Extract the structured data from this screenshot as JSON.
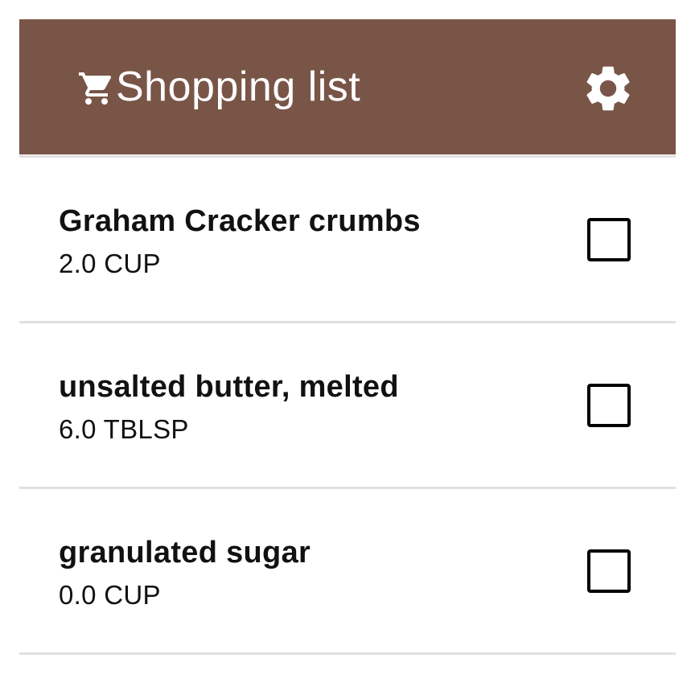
{
  "app_bar": {
    "title": "Shopping list",
    "cart_icon": "shopping-cart-icon",
    "settings_icon": "gear-icon",
    "background_color": "#795548",
    "text_color": "#ffffff"
  },
  "items": [
    {
      "name": "Graham Cracker crumbs",
      "quantity": "2.0 CUP",
      "checked": false
    },
    {
      "name": "unsalted butter, melted",
      "quantity": "6.0 TBLSP",
      "checked": false
    },
    {
      "name": "granulated sugar",
      "quantity": "0.0 CUP",
      "checked": false
    }
  ]
}
